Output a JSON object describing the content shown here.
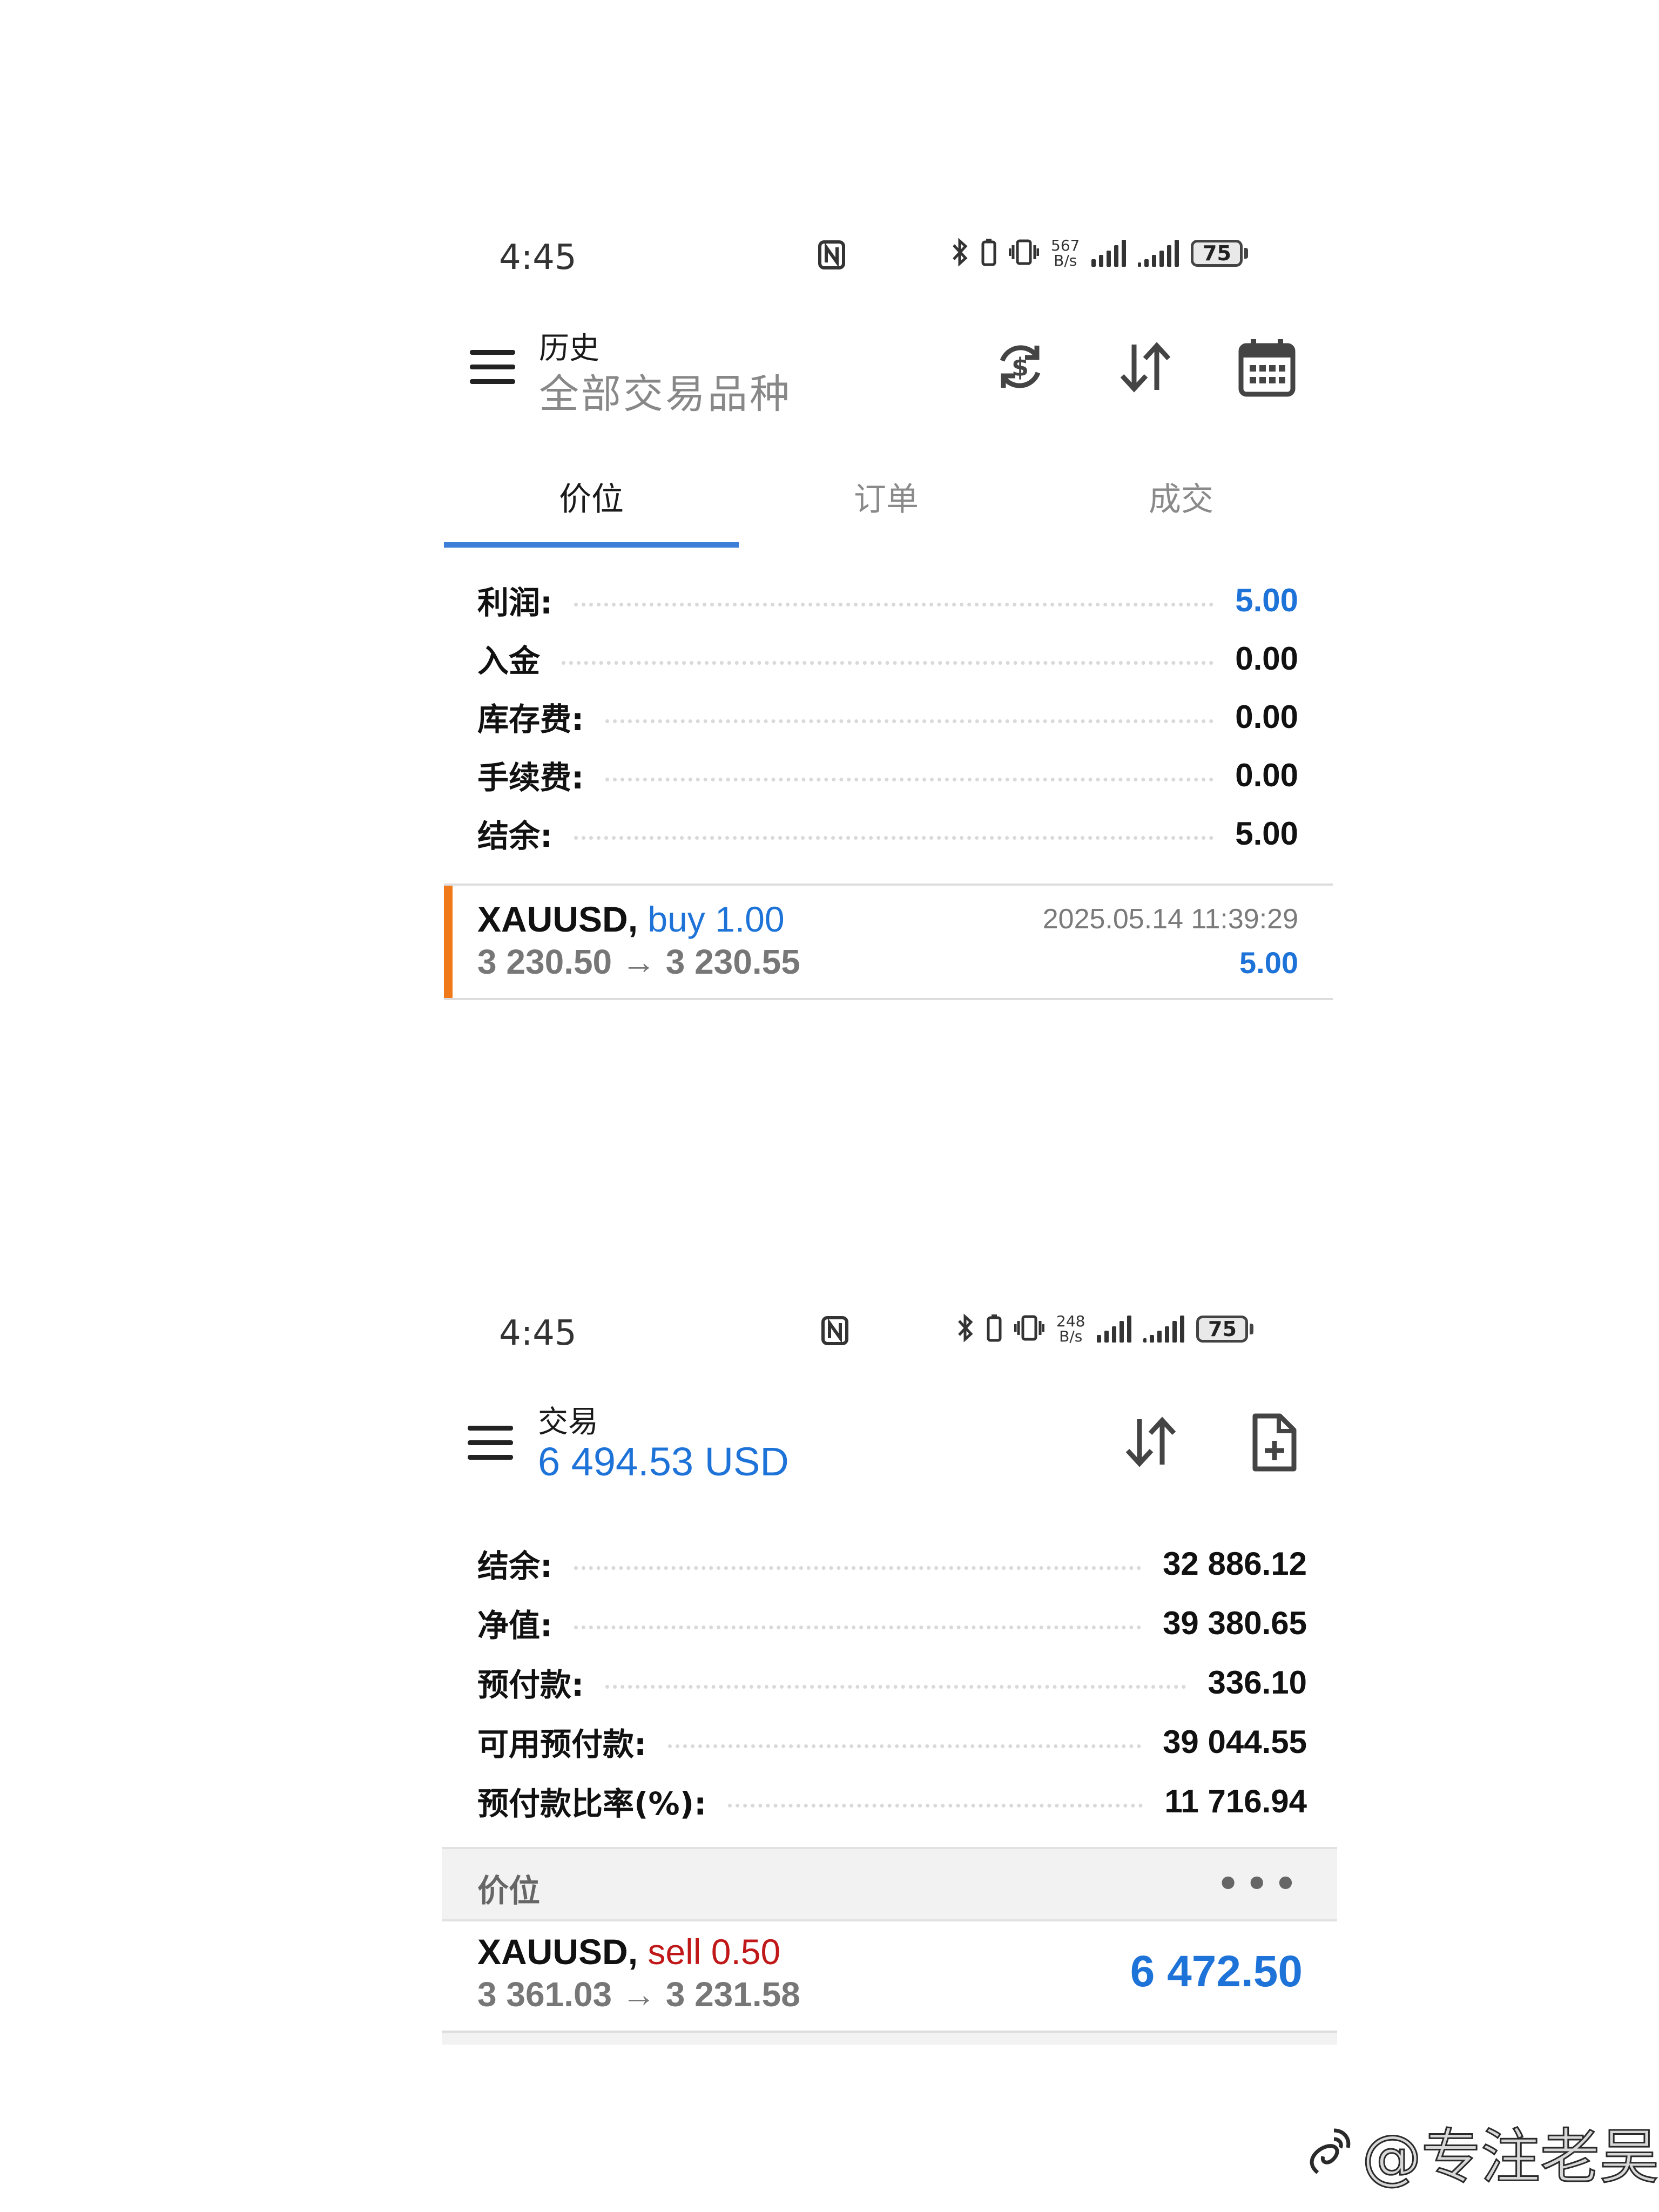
{
  "screen1": {
    "status": {
      "time": "4:45",
      "nfc": "N",
      "speed_value": "567",
      "speed_unit": "B/s",
      "battery": "75"
    },
    "header": {
      "title": "历史",
      "subtitle": "全部交易品种"
    },
    "tabs": [
      "价位",
      "订单",
      "成交"
    ],
    "summary": [
      {
        "label": "利润:",
        "value": "5.00",
        "highlight": true
      },
      {
        "label": "入金",
        "value": "0.00"
      },
      {
        "label": "库存费:",
        "value": "0.00"
      },
      {
        "label": "手续费:",
        "value": "0.00"
      },
      {
        "label": "结余:",
        "value": "5.00"
      }
    ],
    "deal": {
      "symbol": "XAUUSD,",
      "side": "buy 1.00",
      "prices": "3 230.50 → 3 230.55",
      "time": "2025.05.14 11:39:29",
      "profit": "5.00"
    }
  },
  "screen2": {
    "status": {
      "time": "4:45",
      "nfc": "N",
      "speed_value": "248",
      "speed_unit": "B/s",
      "battery": "75"
    },
    "header": {
      "title": "交易",
      "subtitle": "6 494.53 USD"
    },
    "summary": [
      {
        "label": "结余:",
        "value": "32 886.12"
      },
      {
        "label": "净值:",
        "value": "39 380.65"
      },
      {
        "label": "预付款:",
        "value": "336.10"
      },
      {
        "label": "可用预付款:",
        "value": "39 044.55"
      },
      {
        "label": "预付款比率(%):",
        "value": "11 716.94"
      }
    ],
    "section": {
      "label": "价位",
      "more": "•••"
    },
    "position": {
      "symbol": "XAUUSD,",
      "side": "sell 0.50",
      "prices": "3 361.03 → 3 231.58",
      "profit": "6 472.50"
    }
  },
  "watermark": "@专注老吴",
  "colors": {
    "accent_blue": "#1e73d8",
    "sell_red": "#c01818",
    "deal_bar": "#f07a1a",
    "tab_indicator": "#3c7fd8"
  },
  "icons": [
    "menu-icon",
    "currency-exchange-icon",
    "sort-icon",
    "calendar-icon",
    "new-order-icon",
    "bluetooth-icon",
    "vibrate-icon",
    "nfc-icon",
    "signal-icon",
    "battery-icon",
    "more-icon",
    "weibo-icon"
  ]
}
